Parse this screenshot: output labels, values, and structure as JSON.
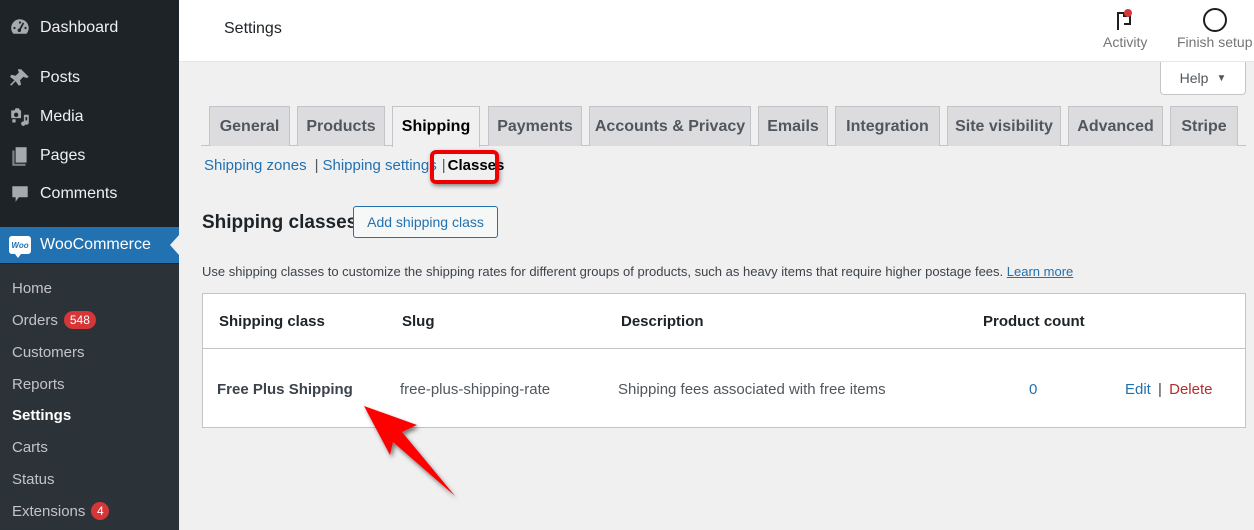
{
  "sidebar": {
    "menu": [
      {
        "label": "Dashboard",
        "icon": "dashboard-icon"
      },
      {
        "label": "Posts",
        "icon": "pushpin-icon"
      },
      {
        "label": "Media",
        "icon": "media-icon"
      },
      {
        "label": "Pages",
        "icon": "pages-icon"
      },
      {
        "label": "Comments",
        "icon": "comment-icon"
      },
      {
        "label": "WooCommerce",
        "icon": "woocommerce-icon",
        "logo_text": "Woo",
        "active": true
      }
    ],
    "submenu": [
      {
        "label": "Home"
      },
      {
        "label": "Orders",
        "badge": "548"
      },
      {
        "label": "Customers"
      },
      {
        "label": "Reports"
      },
      {
        "label": "Settings",
        "current": true
      },
      {
        "label": "Carts"
      },
      {
        "label": "Status"
      },
      {
        "label": "Extensions",
        "badge": "4"
      }
    ]
  },
  "header": {
    "title": "Settings",
    "activity_label": "Activity",
    "finish_setup_label": "Finish setup",
    "help_label": "Help",
    "help_caret": "▼"
  },
  "tabs": [
    {
      "label": "General"
    },
    {
      "label": "Products"
    },
    {
      "label": "Shipping",
      "active": true
    },
    {
      "label": "Payments"
    },
    {
      "label": "Accounts & Privacy"
    },
    {
      "label": "Emails"
    },
    {
      "label": "Integration"
    },
    {
      "label": "Site visibility"
    },
    {
      "label": "Advanced"
    },
    {
      "label": "Stripe"
    }
  ],
  "subnav": {
    "items": [
      "Shipping zones",
      "Shipping settings",
      "Classes"
    ],
    "separator": "|",
    "current": "Classes"
  },
  "section": {
    "title": "Shipping classes",
    "add_button": "Add shipping class",
    "description": "Use shipping classes to customize the shipping rates for different groups of products, such as heavy items that require higher postage fees.",
    "learn_more": "Learn more"
  },
  "table": {
    "columns": [
      "Shipping class",
      "Slug",
      "Description",
      "Product count"
    ],
    "rows": [
      {
        "name": "Free Plus Shipping",
        "slug": "free-plus-shipping-rate",
        "description": "Shipping fees associated with free items",
        "count": "0",
        "edit": "Edit",
        "separator": "|",
        "delete": "Delete"
      }
    ]
  },
  "colors": {
    "sidebar_bg": "#1d2327",
    "accent": "#2271b1",
    "badge": "#d63638",
    "delete": "#b32d2e",
    "annotation": "#ee0000"
  }
}
